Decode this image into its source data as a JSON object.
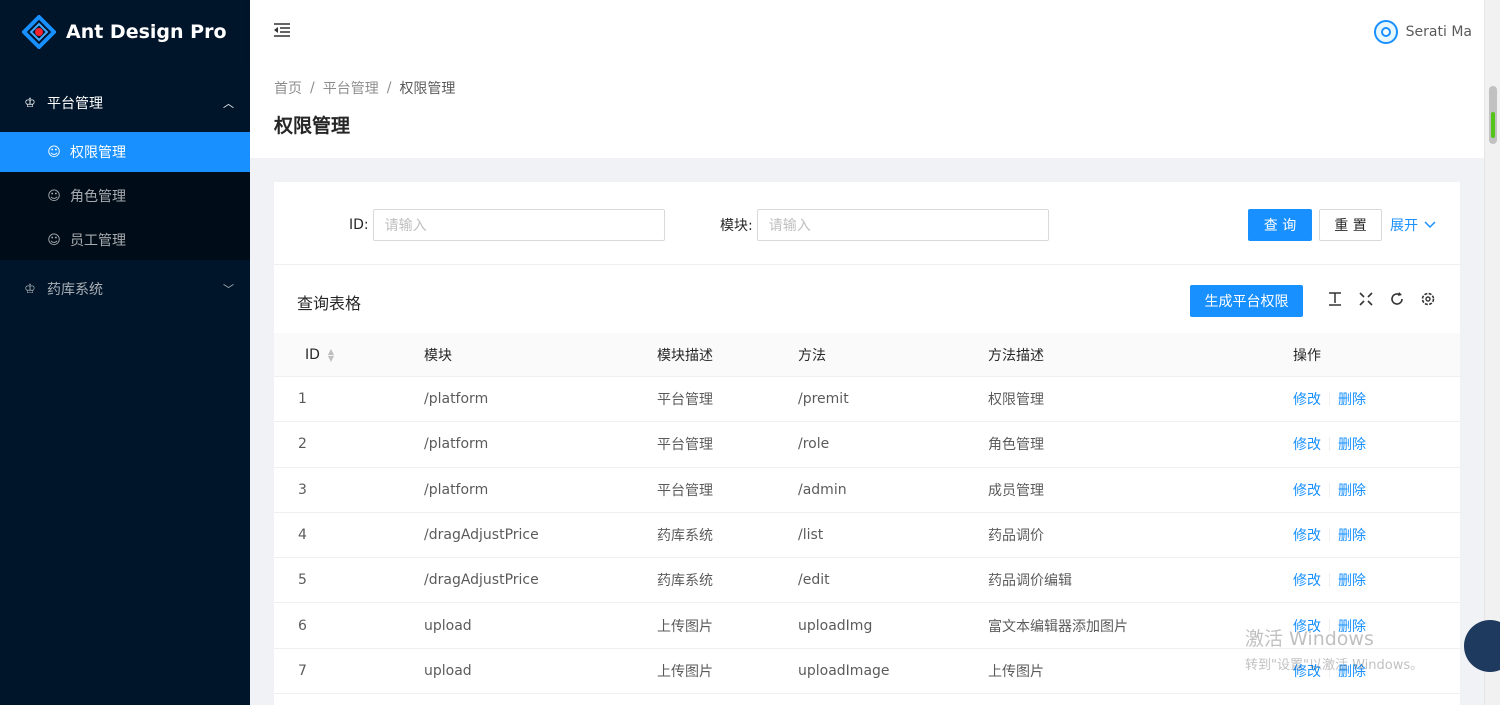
{
  "app": {
    "title": "Ant Design Pro"
  },
  "colors": {
    "primary": "#1890ff",
    "sider": "#001529"
  },
  "sidebar": {
    "groups": [
      {
        "label": "平台管理",
        "icon": "crown-icon",
        "expanded": true,
        "items": [
          {
            "label": "权限管理",
            "icon": "smile-icon",
            "active": true
          },
          {
            "label": "角色管理",
            "icon": "smile-icon",
            "active": false
          },
          {
            "label": "员工管理",
            "icon": "smile-icon",
            "active": false
          }
        ]
      },
      {
        "label": "药库系统",
        "icon": "crown-icon",
        "expanded": false,
        "items": []
      }
    ]
  },
  "header": {
    "user_name": "Serati Ma"
  },
  "breadcrumb": [
    "首页",
    "平台管理",
    "权限管理"
  ],
  "page_title": "权限管理",
  "search": {
    "id_label": "ID",
    "id_placeholder": "请输入",
    "module_label": "模块",
    "module_placeholder": "请输入",
    "query_label": "查 询",
    "reset_label": "重 置",
    "expand_label": "展开"
  },
  "table": {
    "title": "查询表格",
    "create_label": "生成平台权限",
    "columns": [
      "ID",
      "模块",
      "模块描述",
      "方法",
      "方法描述",
      "操作"
    ],
    "edit_label": "修改",
    "delete_label": "删除",
    "rows": [
      [
        "1",
        "/platform",
        "平台管理",
        "/premit",
        "权限管理"
      ],
      [
        "2",
        "/platform",
        "平台管理",
        "/role",
        "角色管理"
      ],
      [
        "3",
        "/platform",
        "平台管理",
        "/admin",
        "成员管理"
      ],
      [
        "4",
        "/dragAdjustPrice",
        "药库系统",
        "/list",
        "药品调价"
      ],
      [
        "5",
        "/dragAdjustPrice",
        "药库系统",
        "/edit",
        "药品调价编辑"
      ],
      [
        "6",
        "upload",
        "上传图片",
        "uploadImg",
        "富文本编辑器添加图片"
      ],
      [
        "7",
        "upload",
        "上传图片",
        "uploadImage",
        "上传图片"
      ]
    ]
  },
  "watermark": {
    "line1": "激活 Windows",
    "line2": "转到\"设置\"以激活 Windows。"
  }
}
